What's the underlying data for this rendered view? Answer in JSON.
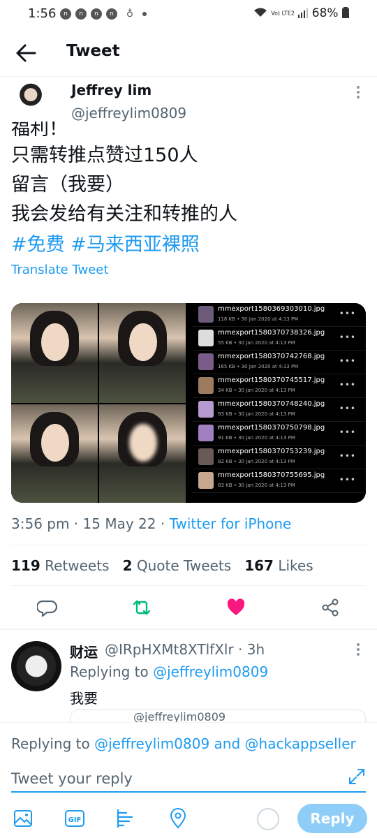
{
  "status_bar": {
    "time": "1:56",
    "battery": "68%",
    "network": "Vo) LTE2"
  },
  "app_bar": {
    "title": "Tweet"
  },
  "tweet": {
    "author_name": "Jeffrey lim",
    "author_handle": "@jeffreylim0809",
    "lines": [
      "福利！",
      "只需转推点赞过150人",
      "留言（我要）",
      "我会发给有关注和转推的人"
    ],
    "hashtags": "#免费 #马来西亚裸照",
    "translate": "Translate Tweet",
    "files": [
      {
        "name": "mmexport1580369303010.jpg",
        "meta": "118 KB • 30 Jan 2020 at 4:13 PM"
      },
      {
        "name": "mmexport1580370738326.jpg",
        "meta": "55 KB • 30 Jan 2020 at 4:13 PM"
      },
      {
        "name": "mmexport1580370742768.jpg",
        "meta": "165 KB • 30 Jan 2020 at 4:13 PM"
      },
      {
        "name": "mmexport1580370745517.jpg",
        "meta": "34 KB • 30 Jan 2020 at 4:13 PM"
      },
      {
        "name": "mmexport1580370748240.jpg",
        "meta": "93 KB • 30 Jan 2020 at 4:13 PM"
      },
      {
        "name": "mmexport1580370750798.jpg",
        "meta": "91 KB • 30 Jan 2020 at 4:13 PM"
      },
      {
        "name": "mmexport1580370753239.jpg",
        "meta": "82 KB • 30 Jan 2020 at 4:13 PM"
      },
      {
        "name": "mmexport1580370755695.jpg",
        "meta": "83 KB • 30 Jan 2020 at 4:13 PM"
      }
    ],
    "time": "3:56 pm",
    "date": "15 May 22",
    "source": "Twitter for iPhone",
    "retweets": "119",
    "retweets_label": "Retweets",
    "quotes": "2",
    "quotes_label": "Quote Tweets",
    "likes": "167",
    "likes_label": "Likes"
  },
  "reply": {
    "name": "财运",
    "handle_time": "@IRpHXMt8XTlfXlr · 3h",
    "replying_prefix": "Replying to",
    "replying_to": "@jeffreylim0809",
    "text": "我要",
    "quote_handle": "@jeffreylim0809"
  },
  "composer": {
    "replying_prefix": "Replying to",
    "mention1": "@jeffreylim0809",
    "and": "and",
    "mention2": "@hackappseller",
    "placeholder": "Tweet your reply",
    "reply_label": "Reply"
  },
  "colors": {
    "accent": "#1d9bf0",
    "like": "#f91880",
    "retweet": "#00ba7c"
  }
}
